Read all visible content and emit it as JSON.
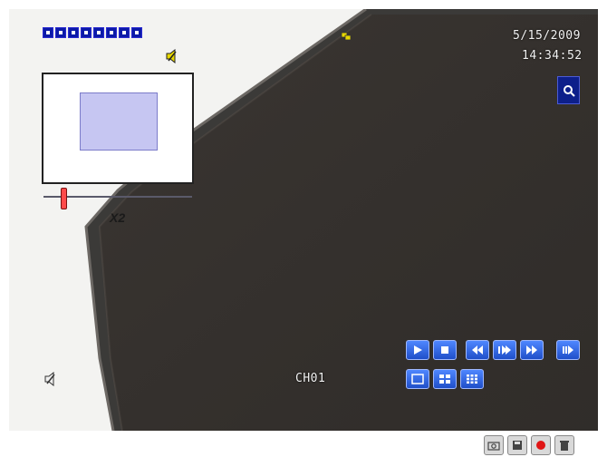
{
  "osd": {
    "date": "5/15/2009",
    "time": "14:34:52",
    "channel_label": "CH01",
    "zoom_level": "X2"
  },
  "channels": {
    "count": 8
  },
  "zoom_slider": {
    "level_fraction": 0.14
  },
  "colors": {
    "osd_blue": "#0b1aa8",
    "button_blue": "#2f63e0",
    "record_red": "#e01515",
    "speaker_yellow": "#e8d800"
  },
  "icons": {
    "search": "search-icon",
    "speaker": "speaker-icon",
    "play": "play-icon",
    "stop": "stop-icon",
    "rewind": "rewind-icon",
    "step": "step-forward-icon",
    "fast_forward": "fast-forward-icon",
    "next_frame": "next-frame-icon",
    "layout_single": "single-view-icon",
    "layout_quad": "quad-view-icon",
    "layout_nine": "nine-view-icon"
  }
}
